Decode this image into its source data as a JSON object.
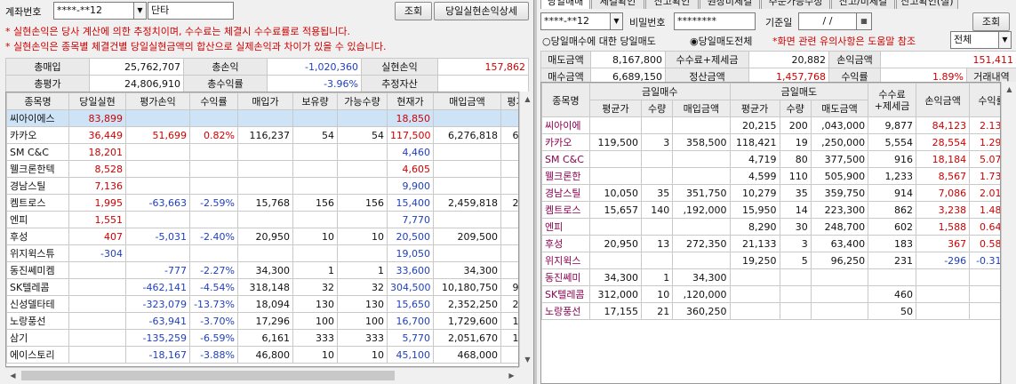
{
  "left": {
    "account_label": "계좌번호",
    "account_value": "****-**12",
    "account_type": "단타",
    "query_btn": "조회",
    "detail_btn": "당일실현손익상세",
    "notes": [
      "* 실현손익은 당사 계산에 의한 추정치이며, 수수료는 체결시 수수료률로 적용됩니다.",
      "* 실현손익은 종목별 체결건별 당일실현금액의 합산으로 실제손익과 차이가 있을 수 있습니다."
    ],
    "summary": {
      "r1": [
        "총매입",
        "25,762,707",
        "총손익",
        "-1,020,360",
        "실현손익",
        "157,862"
      ],
      "r2": [
        "총평가",
        "24,806,910",
        "총수익률",
        "-3.96%",
        "추정자산",
        ""
      ]
    },
    "headers": [
      "종목명",
      "당일실현",
      "평가손익",
      "수익률",
      "매입가",
      "보유량",
      "가능수량",
      "현재가",
      "매입금액",
      "평가"
    ],
    "rows": [
      [
        "씨아이에스",
        "83,899",
        "",
        "",
        "",
        "",
        "",
        "18,850",
        "",
        ""
      ],
      [
        "카카오",
        "36,449",
        "51,699",
        "0.82%",
        "116,237",
        "54",
        "54",
        "117,500",
        "6,276,818",
        "6,3"
      ],
      [
        "SM C&C",
        "18,201",
        "",
        "",
        "",
        "",
        "",
        "4,460",
        "",
        ""
      ],
      [
        "웰크론한텍",
        "8,528",
        "",
        "",
        "",
        "",
        "",
        "4,605",
        "",
        ""
      ],
      [
        "경남스틸",
        "7,136",
        "",
        "",
        "",
        "",
        "",
        "9,900",
        "",
        ""
      ],
      [
        "켐트로스",
        "1,995",
        "-63,663",
        "-2.59%",
        "15,768",
        "156",
        "156",
        "15,400",
        "2,459,818",
        "2,4"
      ],
      [
        "엔피",
        "1,551",
        "",
        "",
        "",
        "",
        "",
        "7,770",
        "",
        ""
      ],
      [
        "후성",
        "407",
        "-5,031",
        "-2.40%",
        "20,950",
        "10",
        "10",
        "20,500",
        "209,500",
        "2"
      ],
      [
        "위지윅스튜",
        "-304",
        "",
        "",
        "",
        "",
        "",
        "19,050",
        "",
        ""
      ],
      [
        "동진쎄미켐",
        "",
        "-777",
        "-2.27%",
        "34,300",
        "1",
        "1",
        "33,600",
        "34,300",
        ""
      ],
      [
        "SK텔레콤",
        "",
        "-462,141",
        "-4.54%",
        "318,148",
        "32",
        "32",
        "304,500",
        "10,180,750",
        "9,7"
      ],
      [
        "신성델타테",
        "",
        "-323,079",
        "-13.73%",
        "18,094",
        "130",
        "130",
        "15,650",
        "2,352,250",
        "2,0"
      ],
      [
        "노랑풍선",
        "",
        "-63,941",
        "-3.70%",
        "17,296",
        "100",
        "100",
        "16,700",
        "1,729,600",
        "1,6"
      ],
      [
        "삼기",
        "",
        "-135,259",
        "-6.59%",
        "6,161",
        "333",
        "333",
        "5,770",
        "2,051,670",
        "1,9"
      ],
      [
        "에이스토리",
        "",
        "-18,167",
        "-3.88%",
        "46,800",
        "10",
        "10",
        "45,100",
        "468,000",
        "4"
      ]
    ]
  },
  "right": {
    "tabs": [
      "당일매매",
      "체결확인",
      "잔고확인",
      "원장미체결",
      "주문가능수정",
      "잔고/미체결",
      "잔고확인(실)"
    ],
    "account_value": "****-**12",
    "pw_label": "비밀번호",
    "pw_value": "********",
    "date_label": "기준일",
    "date_value": "/ /",
    "query_btn": "조회",
    "radio1": "당일매수에 대한 당일매도",
    "radio2": "당일매도전체",
    "warn": "*화면 관련 유의사항은 도움말 참조",
    "filter": "전체",
    "summary": {
      "r1": [
        "매도금액",
        "8,167,800",
        "수수료+제세금",
        "20,882",
        "손익금액",
        "151,411"
      ],
      "r2": [
        "매수금액",
        "6,689,150",
        "정산금액",
        "1,457,768",
        "수익률",
        "1.89%",
        "거래내역"
      ]
    },
    "group_headers": [
      "종목명",
      "금일매수",
      "금일매도",
      "수수료 +제세금",
      "손익금액",
      "수익률"
    ],
    "sub_headers": [
      "평균가",
      "수량",
      "매입금액",
      "평균가",
      "수량",
      "매도금액"
    ],
    "rows": [
      [
        "씨아이에",
        "",
        "",
        "",
        "20,215",
        "200",
        ",043,000",
        "9,877",
        "84,123",
        "2.13%"
      ],
      [
        "카카오",
        "119,500",
        "3",
        "358,500",
        "118,421",
        "19",
        ",250,000",
        "5,554",
        "28,554",
        "1.29%"
      ],
      [
        "SM C&C",
        "",
        "",
        "",
        "4,719",
        "80",
        "377,500",
        "916",
        "18,184",
        "5.07%"
      ],
      [
        "웰크론한",
        "",
        "",
        "",
        "4,599",
        "110",
        "505,900",
        "1,233",
        "8,567",
        "1.73%"
      ],
      [
        "경남스틸",
        "10,050",
        "35",
        "351,750",
        "10,279",
        "35",
        "359,750",
        "914",
        "7,086",
        "2.01%"
      ],
      [
        "켐트로스",
        "15,657",
        "140",
        ",192,000",
        "15,950",
        "14",
        "223,300",
        "862",
        "3,238",
        "1.48%"
      ],
      [
        "엔피",
        "",
        "",
        "",
        "8,290",
        "30",
        "248,700",
        "602",
        "1,588",
        "0.64%"
      ],
      [
        "후성",
        "20,950",
        "13",
        "272,350",
        "21,133",
        "3",
        "63,400",
        "183",
        "367",
        "0.58%"
      ],
      [
        "위지윅스",
        "",
        "",
        "",
        "19,250",
        "5",
        "96,250",
        "231",
        "-296",
        "-0.31%"
      ],
      [
        "동진쎄미",
        "34,300",
        "1",
        "34,300",
        "",
        "",
        "",
        "",
        "",
        ""
      ],
      [
        "SK텔레콤",
        "312,000",
        "10",
        ",120,000",
        "",
        "",
        "",
        "460",
        "",
        ""
      ],
      [
        "노랑풍선",
        "17,155",
        "21",
        "360,250",
        "",
        "",
        "",
        "50",
        "",
        ""
      ]
    ]
  },
  "colors": {
    "neg": "#1f3fbf",
    "pos": "#d00000",
    "select": "#cfe3f7",
    "name": "#8b0050"
  }
}
